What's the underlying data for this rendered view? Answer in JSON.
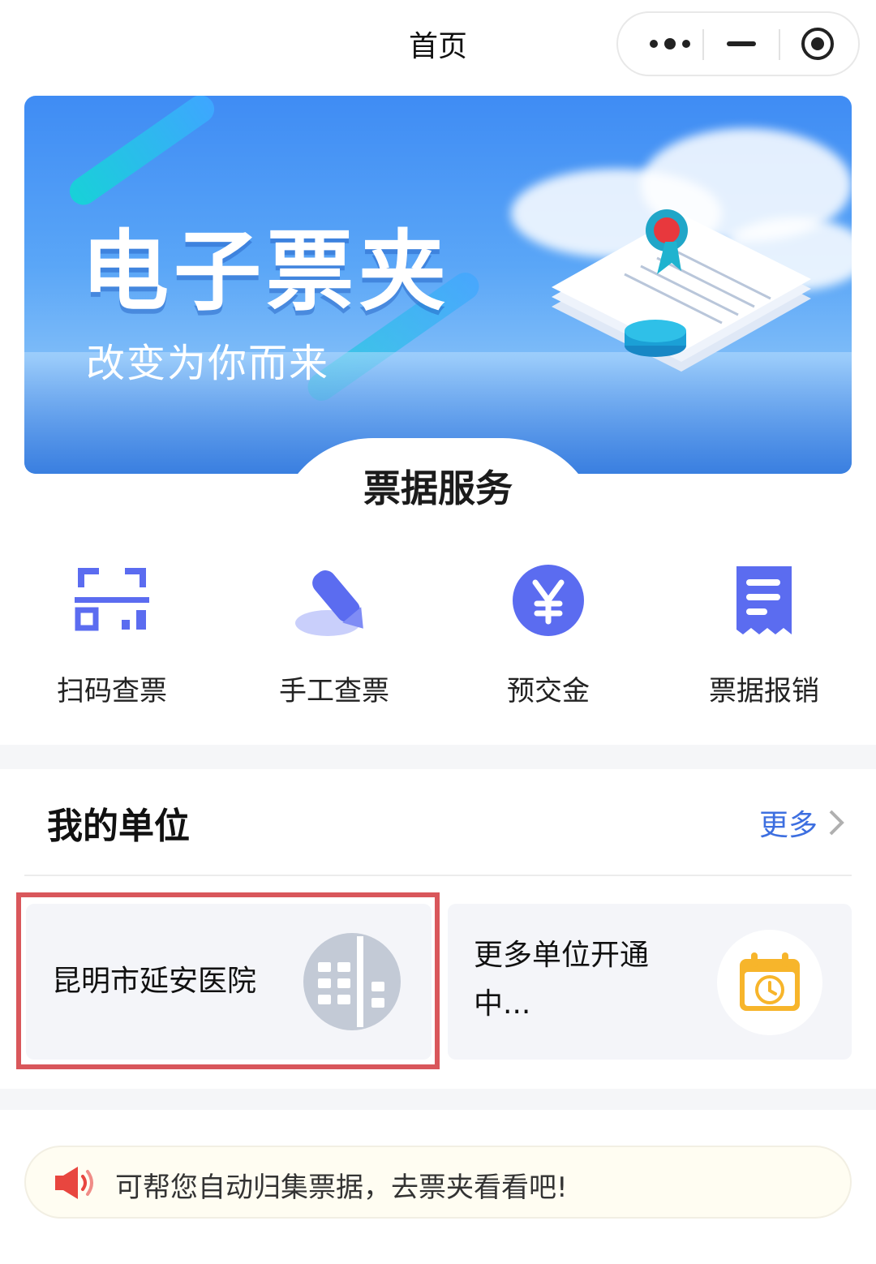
{
  "nav": {
    "title": "首页"
  },
  "banner": {
    "title": "电子票夹",
    "subtitle": "改变为你而来"
  },
  "services": {
    "title": "票据服务",
    "items": [
      {
        "label": "扫码查票",
        "icon": "scan-qr-icon"
      },
      {
        "label": "手工查票",
        "icon": "pen-icon"
      },
      {
        "label": "预交金",
        "icon": "yuan-coin-icon"
      },
      {
        "label": "票据报销",
        "icon": "receipt-icon"
      }
    ]
  },
  "units": {
    "title": "我的单位",
    "more_label": "更多",
    "cards": [
      {
        "name": "昆明市延安医院",
        "icon": "building-icon"
      },
      {
        "name_line1": "更多单位开通",
        "name_line2": "中...",
        "icon": "calendar-clock-icon"
      }
    ]
  },
  "notice": {
    "text": "可帮您自动归集票据，去票夹看看吧!",
    "icon": "speaker-icon"
  },
  "colors": {
    "accent": "#5b6cf0",
    "link": "#3d6fe0",
    "highlight": "#d9575b",
    "calendar": "#f7b52b"
  }
}
